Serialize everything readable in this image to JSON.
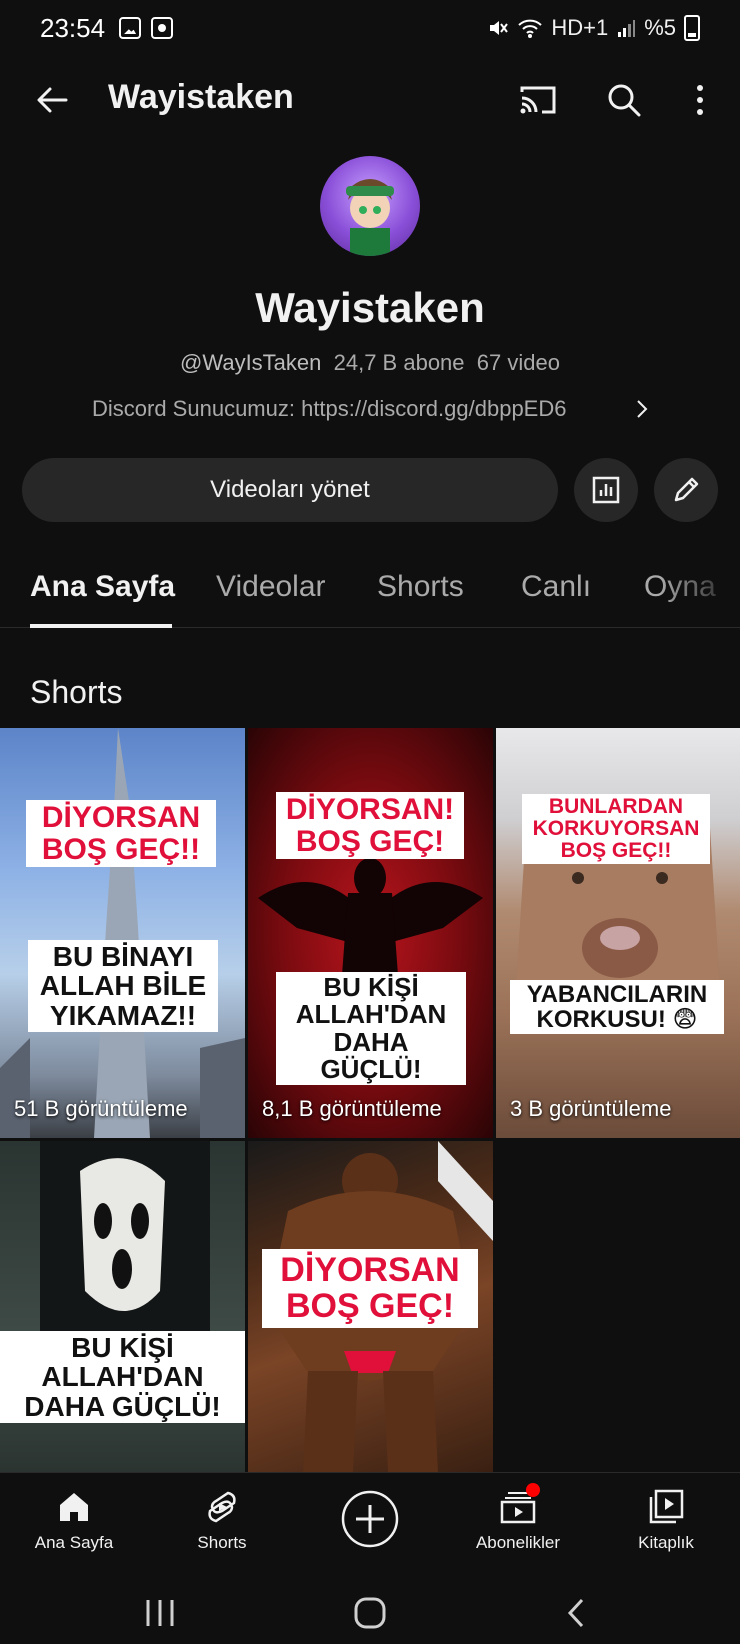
{
  "status_bar": {
    "time": "23:54",
    "signal_text": "HD+1",
    "battery_text": "%5"
  },
  "appbar": {
    "title": "Wayistaken",
    "icons": [
      "back-icon",
      "cast-icon",
      "search-icon",
      "more-vert-icon"
    ]
  },
  "channel": {
    "name": "Wayistaken",
    "handle": "@WayIsTaken",
    "subscribers": "24,7 B abone",
    "videos": "67 video",
    "description": "Discord Sunucumuz: https://discord.gg/dbppED6"
  },
  "actions": {
    "manage_label": "Videoları yönet"
  },
  "tabs": [
    {
      "label": "Ana Sayfa",
      "active": true
    },
    {
      "label": "Videolar",
      "active": false
    },
    {
      "label": "Shorts",
      "active": false
    },
    {
      "label": "Canlı",
      "active": false
    },
    {
      "label": "Oyna",
      "active": false
    }
  ],
  "section": {
    "title": "Shorts"
  },
  "shorts": [
    {
      "top_caption": "DİYORSAN BOŞ GEÇ!!",
      "bottom_caption": "BU BİNAYI ALLAH BİLE YIKAMAZ!!",
      "views": "51 B görüntüleme"
    },
    {
      "top_caption": "DİYORSAN! BOŞ GEÇ!",
      "bottom_caption": "BU KİŞİ ALLAH'DAN DAHA GÜÇLÜ!",
      "views": "8,1 B görüntüleme"
    },
    {
      "top_caption": "BUNLARDAN KORKUYORSAN BOŞ GEÇ!!",
      "bottom_caption": "YABANCILARIN KORKUSU! 😨",
      "views": "3 B görüntüleme"
    },
    {
      "top_caption": "",
      "bottom_caption": "BU KİŞİ ALLAH'DAN DAHA GÜÇLÜ!",
      "views": ""
    },
    {
      "top_caption": "DİYORSAN BOŞ GEÇ!",
      "bottom_caption": "",
      "views": ""
    }
  ],
  "bottom_nav": {
    "items": [
      {
        "label": "Ana Sayfa",
        "icon": "home-icon"
      },
      {
        "label": "Shorts",
        "icon": "shorts-icon"
      },
      {
        "label": "",
        "icon": "create-icon"
      },
      {
        "label": "Abonelikler",
        "icon": "subscriptions-icon"
      },
      {
        "label": "Kitaplık",
        "icon": "library-icon"
      }
    ]
  },
  "colors": {
    "background": "#0f0f0f",
    "button_bg": "#272727",
    "caption_red": "#e0103a",
    "notification": "#ff0000"
  }
}
